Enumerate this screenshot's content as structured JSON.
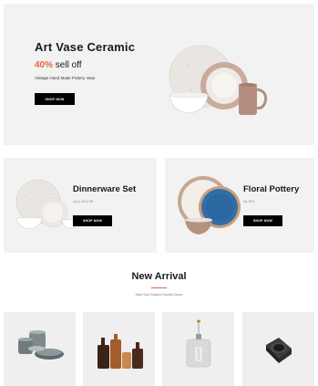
{
  "hero": {
    "title": "Art Vase Ceramic",
    "discount": "40%",
    "discount_suffix": " sell off",
    "description": "Vintage Hand Made Pottery Vase",
    "button_label": "SHOP NOW"
  },
  "banners": [
    {
      "title": "Dinnerware Set",
      "price": "Up to 40% Off",
      "button_label": "SHOP NOW"
    },
    {
      "title": "Floral Pottery",
      "price": "Up 30%",
      "button_label": "SHOP NOW"
    }
  ],
  "new_arrival": {
    "title": "New Arrival",
    "subtitle": "Start Your Today's Favorite Decor"
  },
  "products": [
    {
      "icon": "stacked-bowls-image"
    },
    {
      "icon": "wooden-boards-image"
    },
    {
      "icon": "pendant-lamp-image"
    },
    {
      "icon": "black-cup-image"
    }
  ],
  "colors": {
    "accent": "#e0693f",
    "panel": "#f2f2f2",
    "button": "#000000"
  }
}
